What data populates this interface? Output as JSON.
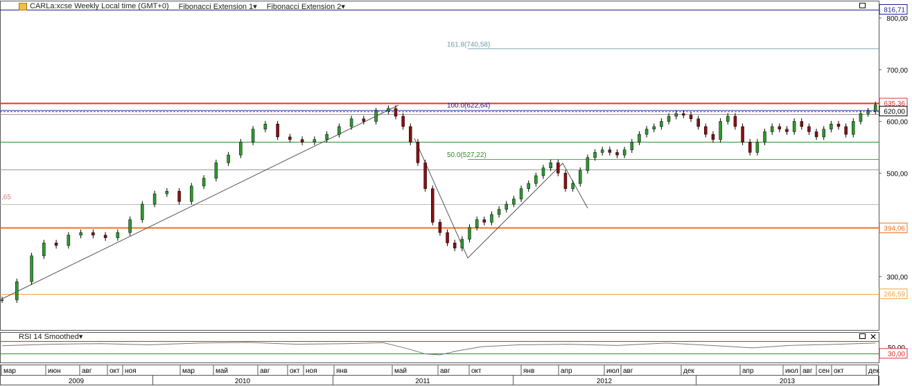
{
  "toolbar": {
    "symbol": "CARLa:xcse Weekly Local time (GMT+0)",
    "indicator1": "Fibonacci Extension 1",
    "indicator2": "Fibonacci Extension 2",
    "rsi_label": "RSI 14 Smoothed"
  },
  "chart_data": {
    "type": "candlestick",
    "y_ticks": [
      "800,00",
      "700,00",
      "600,00",
      "500,00",
      "300,00"
    ],
    "y_tick_values": [
      800,
      700,
      600,
      500,
      300
    ],
    "price_labels": [
      {
        "text": "816,71",
        "value": 816.71,
        "color": "#1a1a9c"
      },
      {
        "text": "635,36",
        "value": 635.36,
        "color": "#e03030"
      },
      {
        "text": "620,00",
        "value": 620,
        "color": "#000000"
      },
      {
        "text": "394,06",
        "value": 394.06,
        "color": "#f07020"
      },
      {
        "text": "266,59",
        "value": 266.59,
        "color": "#f0a040"
      }
    ],
    "left_partial_label": ",65",
    "fib_levels": [
      {
        "text": "161.8(740,58)",
        "value": 740.58,
        "color": "#6a9aa8"
      },
      {
        "text": "100.0(622,64)",
        "value": 622.64,
        "color": "#1a1a9c"
      },
      {
        "text": "50.0(527,22)",
        "value": 527.22,
        "color": "#2a8a2a"
      }
    ],
    "horizontal_lines": [
      {
        "value": 816.71,
        "color": "#1a1a9c"
      },
      {
        "value": 635.36,
        "color": "#e03030"
      },
      {
        "value": 620,
        "color": "#b01010",
        "dash": true
      },
      {
        "value": 614,
        "color": "#999999"
      },
      {
        "value": 560,
        "color": "#2a8a2a"
      },
      {
        "value": 507,
        "color": "#999999"
      },
      {
        "value": 440,
        "color": "#bbbbbb"
      },
      {
        "value": 394.06,
        "color": "#f07020"
      },
      {
        "value": 266.59,
        "color": "#f0a040"
      }
    ],
    "rsi": {
      "ticks": [
        "50,00"
      ],
      "labels": [
        {
          "text": "30,00",
          "value": 30
        }
      ],
      "levels": [
        70,
        30
      ]
    },
    "x_months": [
      "мар",
      "июн",
      "авг",
      "окт",
      "ноя",
      "мар",
      "май",
      "авг",
      "окт",
      "ноя",
      "янв",
      "май",
      "авг",
      "окт",
      "янв",
      "апр",
      "июл",
      "авг",
      "дек",
      "апр",
      "июл",
      "авг",
      "сен",
      "окт",
      "дек"
    ],
    "x_years": [
      "2009",
      "2010",
      "2011",
      "2012",
      "2013"
    ],
    "close_points": [
      [
        0,
        255
      ],
      [
        6,
        290
      ],
      [
        12,
        340
      ],
      [
        17,
        365
      ],
      [
        22,
        360
      ],
      [
        27,
        380
      ],
      [
        32,
        385
      ],
      [
        37,
        380
      ],
      [
        42,
        375
      ],
      [
        47,
        385
      ],
      [
        52,
        410
      ],
      [
        57,
        440
      ],
      [
        62,
        460
      ],
      [
        67,
        465
      ],
      [
        72,
        445
      ],
      [
        77,
        475
      ],
      [
        82,
        490
      ],
      [
        87,
        520
      ],
      [
        92,
        535
      ],
      [
        97,
        560
      ],
      [
        102,
        585
      ],
      [
        107,
        595
      ],
      [
        112,
        570
      ],
      [
        117,
        565
      ],
      [
        122,
        560
      ],
      [
        127,
        565
      ],
      [
        132,
        575
      ],
      [
        137,
        590
      ],
      [
        142,
        605
      ],
      [
        147,
        600
      ],
      [
        152,
        620
      ],
      [
        157,
        625
      ],
      [
        160,
        610
      ],
      [
        163,
        590
      ],
      [
        166,
        560
      ],
      [
        169,
        520
      ],
      [
        172,
        470
      ],
      [
        175,
        405
      ],
      [
        178,
        385
      ],
      [
        181,
        365
      ],
      [
        184,
        355
      ],
      [
        187,
        372
      ],
      [
        190,
        395
      ],
      [
        193,
        410
      ],
      [
        196,
        405
      ],
      [
        199,
        420
      ],
      [
        202,
        430
      ],
      [
        205,
        440
      ],
      [
        208,
        450
      ],
      [
        211,
        470
      ],
      [
        214,
        480
      ],
      [
        217,
        495
      ],
      [
        220,
        510
      ],
      [
        223,
        520
      ],
      [
        226,
        500
      ],
      [
        229,
        470
      ],
      [
        232,
        480
      ],
      [
        235,
        505
      ],
      [
        238,
        530
      ],
      [
        241,
        540
      ],
      [
        244,
        545
      ],
      [
        247,
        540
      ],
      [
        250,
        535
      ],
      [
        253,
        545
      ],
      [
        256,
        560
      ],
      [
        259,
        575
      ],
      [
        262,
        585
      ],
      [
        265,
        590
      ],
      [
        268,
        600
      ],
      [
        271,
        610
      ],
      [
        274,
        615
      ],
      [
        277,
        612
      ],
      [
        280,
        605
      ],
      [
        283,
        590
      ],
      [
        286,
        575
      ],
      [
        289,
        565
      ],
      [
        292,
        600
      ],
      [
        295,
        610
      ],
      [
        298,
        590
      ],
      [
        301,
        560
      ],
      [
        304,
        540
      ],
      [
        307,
        560
      ],
      [
        310,
        580
      ],
      [
        313,
        590
      ],
      [
        316,
        585
      ],
      [
        319,
        580
      ],
      [
        322,
        600
      ],
      [
        325,
        590
      ],
      [
        328,
        580
      ],
      [
        331,
        570
      ],
      [
        334,
        585
      ],
      [
        337,
        595
      ],
      [
        340,
        590
      ],
      [
        343,
        575
      ],
      [
        346,
        600
      ],
      [
        349,
        615
      ],
      [
        352,
        620
      ],
      [
        355,
        632
      ]
    ],
    "rsi_points": [
      [
        0,
        55
      ],
      [
        20,
        60
      ],
      [
        40,
        62
      ],
      [
        60,
        58
      ],
      [
        80,
        64
      ],
      [
        100,
        66
      ],
      [
        120,
        60
      ],
      [
        140,
        62
      ],
      [
        155,
        65
      ],
      [
        165,
        45
      ],
      [
        172,
        28
      ],
      [
        178,
        25
      ],
      [
        185,
        38
      ],
      [
        195,
        52
      ],
      [
        210,
        58
      ],
      [
        230,
        60
      ],
      [
        250,
        56
      ],
      [
        270,
        64
      ],
      [
        290,
        55
      ],
      [
        305,
        48
      ],
      [
        320,
        56
      ],
      [
        340,
        60
      ],
      [
        355,
        64
      ]
    ]
  }
}
